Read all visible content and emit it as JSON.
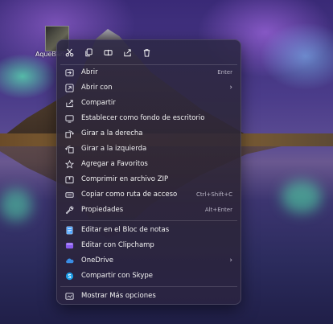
{
  "desktop": {
    "icon_label": "AqueBan"
  },
  "toolbar": [
    {
      "name": "cut-button",
      "icon": "scissors-icon"
    },
    {
      "name": "copy-button",
      "icon": "copy-icon"
    },
    {
      "name": "rename-button",
      "icon": "rename-icon"
    },
    {
      "name": "share-button",
      "icon": "share-icon"
    },
    {
      "name": "delete-button",
      "icon": "trash-icon"
    }
  ],
  "menu": {
    "items": [
      {
        "label": "Abrir",
        "shortcut": "Enter",
        "icon": "open-icon"
      },
      {
        "label": "Abrir con",
        "submenu": "›",
        "icon": "open-with-icon"
      },
      {
        "label": "Compartir",
        "icon": "share-icon"
      },
      {
        "label": "Establecer como fondo de escritorio",
        "icon": "wallpaper-icon"
      },
      {
        "label": "Girar a la derecha",
        "icon": "rotate-right-icon"
      },
      {
        "label": "Girar a la izquierda",
        "icon": "rotate-left-icon"
      },
      {
        "label": "Agregar a Favoritos",
        "icon": "star-icon"
      },
      {
        "label": "Comprimir en archivo ZIP",
        "icon": "zip-icon"
      },
      {
        "label": "Copiar como ruta de acceso",
        "shortcut": "Ctrl+Shift+C",
        "icon": "path-icon"
      },
      {
        "label": "Propiedades",
        "shortcut": "Alt+Enter",
        "icon": "wrench-icon"
      },
      {
        "label": "Editar en el Bloc de notas",
        "icon": "notepad-icon"
      },
      {
        "label": "Editar con Clipchamp",
        "icon": "clipchamp-icon"
      },
      {
        "label": "OneDrive",
        "submenu": "›",
        "icon": "onedrive-icon"
      },
      {
        "label": "Compartir con Skype",
        "icon": "skype-icon"
      },
      {
        "label": "Mostrar Más opciones",
        "icon": "more-options-icon"
      }
    ]
  },
  "colors": {
    "accent_onedrive": "#3a8ee6",
    "accent_skype": "#1c9ee8",
    "accent_clipchamp": "#8a5cf0",
    "accent_notepad": "#4aa3ff"
  }
}
